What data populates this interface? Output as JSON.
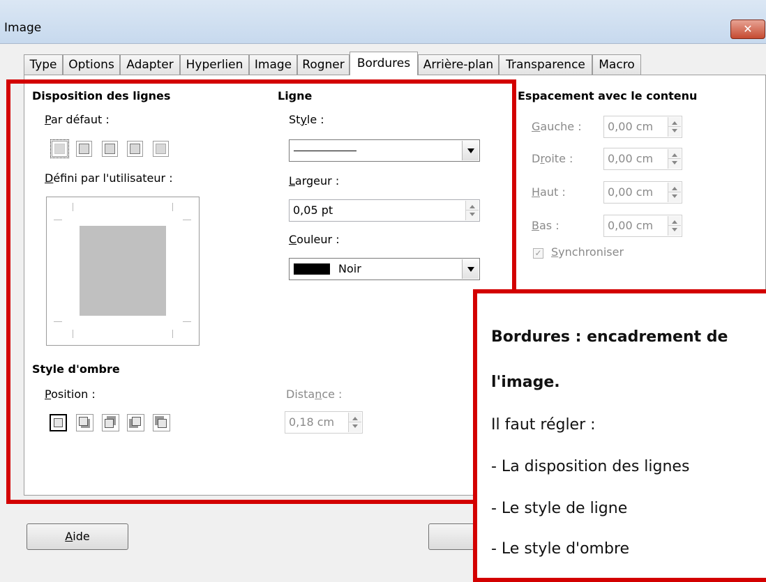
{
  "window": {
    "title": "Image",
    "close_symbol": "✕"
  },
  "tabs": [
    "Type",
    "Options",
    "Adapter",
    "Hyperlien",
    "Image",
    "Rogner",
    "Bordures",
    "Arrière-plan",
    "Transparence",
    "Macro"
  ],
  "active_tab": "Bordures",
  "disposition": {
    "heading": "Disposition des lignes",
    "default_label_u": "P",
    "default_label_rest": "ar défaut :",
    "user_label_u": "D",
    "user_label_rest": "éfini par l'utilisateur :"
  },
  "ligne": {
    "heading": "Ligne",
    "style_label_pre": "St",
    "style_label_u": "y",
    "style_label_rest": "le :",
    "width_label_u": "L",
    "width_label_rest": "argeur :",
    "width_value": "0,05 pt",
    "color_label_u": "C",
    "color_label_rest": "ouleur :",
    "color_value": "Noir",
    "color_swatch": "#000000"
  },
  "spacing": {
    "heading": "Espacement avec le contenu",
    "rows": [
      {
        "u": "G",
        "rest": "auche :",
        "value": "0,00 cm"
      },
      {
        "pre": "D",
        "u": "r",
        "rest": "oite :",
        "value": "0,00 cm"
      },
      {
        "u": "H",
        "rest": "aut :",
        "value": "0,00 cm"
      },
      {
        "u": "B",
        "rest": "as :",
        "value": "0,00 cm"
      }
    ],
    "sync_u": "S",
    "sync_rest": "ynchroniser"
  },
  "shadow": {
    "heading": "Style d'ombre",
    "position_label_u": "P",
    "position_label_rest": "osition :",
    "distance_label_pre": "Dista",
    "distance_label_u": "n",
    "distance_label_rest": "ce :",
    "distance_value": "0,18 cm"
  },
  "annotation": {
    "line1": "Bordures : encadrement de",
    "line2": "l'image.",
    "line3": "Il faut régler :",
    "line4": "- La disposition des lignes",
    "line5": "- Le style de ligne",
    "line6": "- Le style d'ombre"
  },
  "buttons": {
    "help_u": "A",
    "help_rest": "ide"
  },
  "colors": {
    "highlight": "#d30000"
  }
}
